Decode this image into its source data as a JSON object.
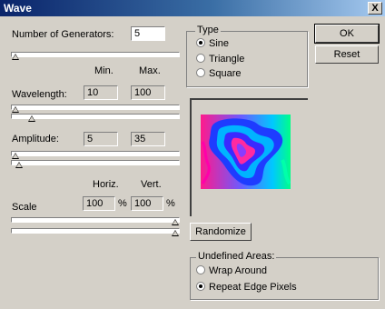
{
  "window": {
    "title": "Wave",
    "close_symbol": "X"
  },
  "generators": {
    "label": "Number of Generators:",
    "value": "5"
  },
  "headers": {
    "min": "Min.",
    "max": "Max.",
    "horiz": "Horiz.",
    "vert": "Vert."
  },
  "wavelength": {
    "label": "Wavelength:",
    "min": "10",
    "max": "100"
  },
  "amplitude": {
    "label": "Amplitude:",
    "min": "5",
    "max": "35"
  },
  "scale": {
    "label": "Scale",
    "horiz": "100",
    "vert": "100",
    "unit": "%"
  },
  "type": {
    "label": "Type",
    "options": [
      "Sine",
      "Triangle",
      "Square"
    ],
    "selected": "Sine"
  },
  "buttons": {
    "ok": "OK",
    "reset": "Reset",
    "randomize": "Randomize"
  },
  "undefined_areas": {
    "label": "Undefined Areas:",
    "options": [
      "Wrap Around",
      "Repeat Edge Pixels"
    ],
    "selected": "Repeat Edge Pixels"
  },
  "sliders": {
    "generators": 0,
    "wavelength_min": 0.0,
    "wavelength_max": 0.1,
    "amplitude_min": 0.0,
    "amplitude_max": 0.02,
    "scale_horiz": 1.0,
    "scale_vert": 1.0
  }
}
